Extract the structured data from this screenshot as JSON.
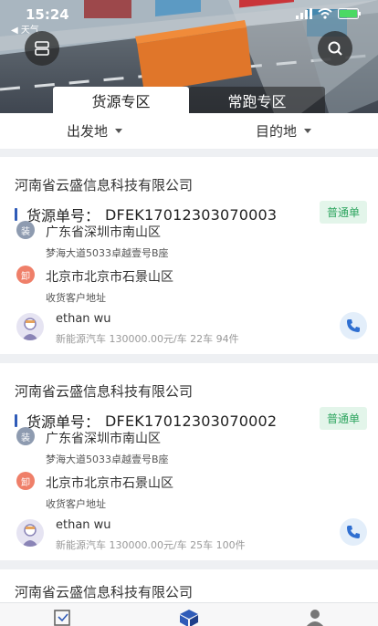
{
  "status": {
    "time": "15:24",
    "back_label": "◀ 天气"
  },
  "tabs": [
    {
      "label": "货源专区",
      "active": true
    },
    {
      "label": "常跑专区",
      "active": false
    }
  ],
  "filters": {
    "origin": "出发地",
    "destination": "目的地"
  },
  "labels": {
    "order_prefix": "货源单号："
  },
  "cards": [
    {
      "company": "河南省云盛信息科技有限公司",
      "order_no": "DFEK17012303070003",
      "badge": "普通单",
      "load_icon": "装",
      "load_city": "广东省深圳市南山区",
      "load_detail": "梦海大道5033卓越壹号B座",
      "unload_icon": "卸",
      "unload_city": "北京市北京市石景山区",
      "unload_detail": "收货客户地址",
      "user": "ethan wu",
      "meta": "新能源汽车 130000.00元/车 22车 94件"
    },
    {
      "company": "河南省云盛信息科技有限公司",
      "order_no": "DFEK17012303070002",
      "badge": "普通单",
      "load_icon": "装",
      "load_city": "广东省深圳市南山区",
      "load_detail": "梦海大道5033卓越壹号B座",
      "unload_icon": "卸",
      "unload_city": "北京市北京市石景山区",
      "unload_detail": "收货客户地址",
      "user": "ethan wu",
      "meta": "新能源汽车 130000.00元/车 25车 100件"
    },
    {
      "company": "河南省云盛信息科技有限公司"
    }
  ],
  "colors": {
    "accent": "#2f5bb8",
    "badge_bg": "#e3f5ea",
    "badge_text": "#2ea560",
    "load_icon": "#8e9bb0",
    "unload_icon": "#ef7f69"
  },
  "icons": [
    "menu-icon",
    "search-icon",
    "signal-icon",
    "wifi-icon",
    "battery-icon",
    "caret-down-icon",
    "phone-icon",
    "nav-goods-icon",
    "nav-cargo-icon",
    "nav-user-icon"
  ]
}
